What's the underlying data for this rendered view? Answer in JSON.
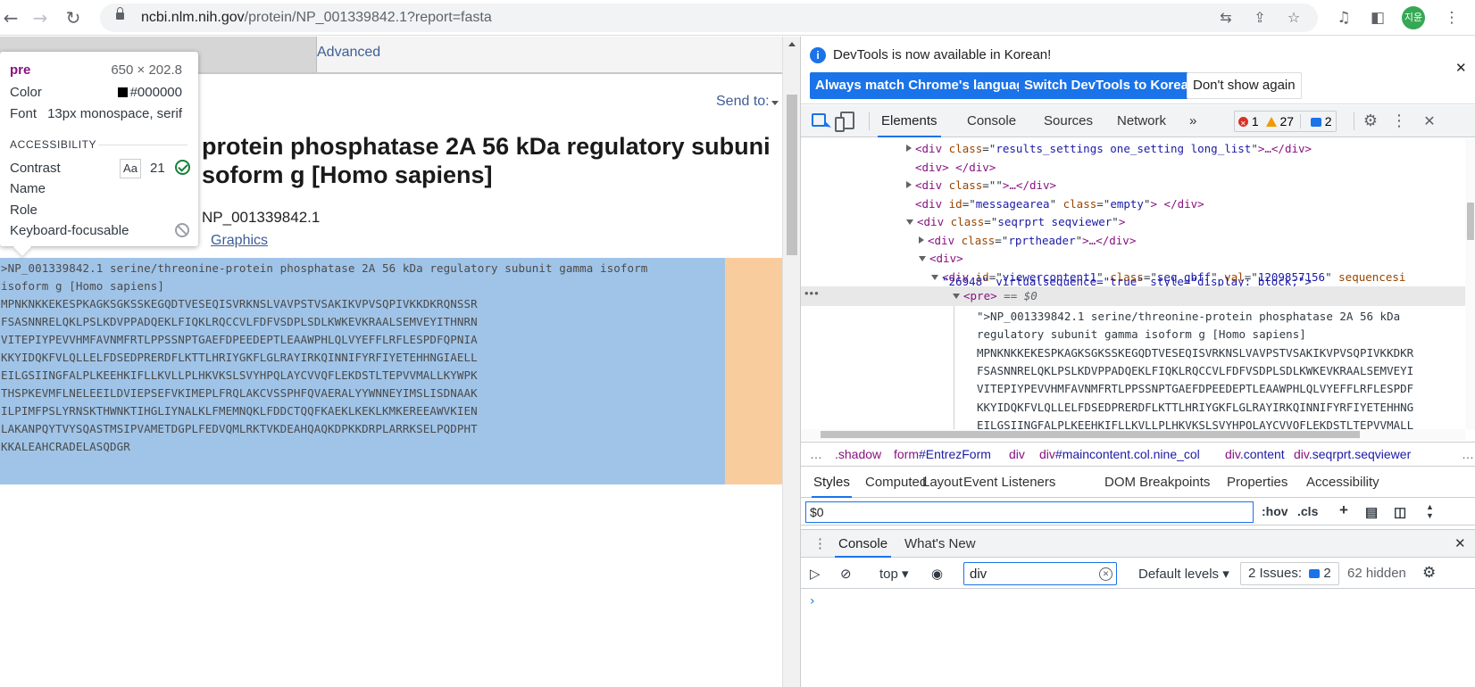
{
  "browser": {
    "url_host": "ncbi.nlm.nih.gov",
    "url_path": "/protein/NP_001339842.1?report=fasta",
    "avatar_label": "지윤",
    "colors": {
      "avatar": "#34a853"
    }
  },
  "page": {
    "advanced_link": "Advanced",
    "send_to": "Send to:",
    "title_line1": "protein phosphatase 2A 56 kDa regulatory subuni",
    "title_line2": "soform g [Homo sapiens]",
    "accession": "NP_001339842.1",
    "graphics_link": "Graphics",
    "fasta_lines": [
      ">NP_001339842.1 serine/threonine-protein phosphatase 2A 56 kDa regulatory subunit gamma isoform",
      "isoform g [Homo sapiens]",
      "MPNKNKKEKESPKAGKSGKSSKEGQDTVESEQISVRKNSLVAVPSTVSAKIKVPVSQPIVKKDKRQNSSR",
      "FSASNNRELQKLPSLKDVPPADQEKLFIQKLRQCCVLFDFVSDPLSDLKWKEVKRAALSEMVEYITHNRN",
      "VITEPIYPEVVHMFAVNMFRTLPPSSNPTGAEFDPEEDEPTLEAAWPHLQLVYEFFLRFLESPDFQPNIA",
      "KKYIDQKFVLQLLELFDSEDPRERDFLKTTLHRIYGKFLGLRAYIRKQINNIFYRFIYETEHHNGIAELL",
      "EILGSIINGFALPLKEEHKIFLLKVLLPLHKVKSLSVYHPQLAYCVVQFLEKDSTLTEPVVMALLKYWPK",
      "THSPKEVMFLNELEEILDVIEPSEFVKIMEPLFRQLAKCVSSPHFQVAERALYYWNNEYIMSLISDNAAK",
      "ILPIMFPSLYRNSKTHWNKTIHGLIYNALKLFMEMNQKLFDDCTQQFKAEKLKEKLKMKEREEAWVKIEN",
      "LAKANPQYTVYSQASTMSIPVAMETDGPLFEDVQMLRKTVKDEAHQAQKDPKKDRPLARRKSELPQDPHT",
      "KKALEAHCRADELASQDGR"
    ],
    "colors": {
      "pre_selection": "#a0c4e8",
      "padding_highlight": "#f9cc9d",
      "link": "#3e5d96"
    }
  },
  "tooltip": {
    "tag": "pre",
    "size": "650 × 202.8",
    "color_label": "Color",
    "color_value": "#000000",
    "font_label": "Font",
    "font_value": "13px monospace, serif",
    "section": "ACCESSIBILITY",
    "contrast_label": "Contrast",
    "contrast_aa": "Aa",
    "contrast_value": "21",
    "name_label": "Name",
    "role_label": "Role",
    "focus_label": "Keyboard-focusable"
  },
  "devtools": {
    "infobar": {
      "message": "DevTools is now available in Korean!",
      "btn_match": "Always match Chrome's language",
      "btn_switch": "Switch DevTools to Korean",
      "btn_dismiss": "Don't show again"
    },
    "tabs": [
      "Elements",
      "Console",
      "Sources",
      "Network"
    ],
    "more_tabs": "»",
    "errors": "1",
    "warnings": "27",
    "messages": "2",
    "elements": {
      "lines": [
        {
          "tag": "div",
          "attrs": [
            [
              "class",
              "results_settings one_setting long_list"
            ]
          ],
          "suffix": ">…</div>"
        },
        {
          "tag": "div",
          "attrs": [],
          "suffix": "> </div>"
        },
        {
          "tag": "div",
          "attrs": [
            [
              "class",
              ""
            ]
          ],
          "suffix": ">…</div>"
        },
        {
          "tag": "div",
          "attrs": [
            [
              "id",
              "messagearea"
            ],
            [
              "class",
              "empty"
            ]
          ],
          "suffix": "> </div>"
        },
        {
          "tag": "div",
          "attrs": [
            [
              "class",
              "seqrprt seqviewer"
            ]
          ],
          "suffix": ">"
        },
        {
          "tag": "div",
          "attrs": [
            [
              "class",
              "rprtheader"
            ]
          ],
          "suffix": ">…</div>"
        },
        {
          "tag": "div",
          "attrs": [],
          "suffix": ">"
        },
        {
          "tag": "div",
          "attrs": [
            [
              "id",
              "viewercontent1"
            ],
            [
              "class",
              "seq gbff"
            ],
            [
              "val",
              "1209857156"
            ],
            [
              "sequencesi",
              ""
            ]
          ],
          "suffix": ""
        }
      ],
      "continuation": "\"26948\" virtualsequence=\"true\" style=\"display: block;\">",
      "selected_tag": "<pre>",
      "selected_ref": " == $0",
      "seq_lines": [
        "\">NP_001339842.1 serine/threonine-protein phosphatase 2A 56 kDa",
        "regulatory subunit gamma isoform g [Homo sapiens]",
        "MPNKNKKEKESPKAGKSGKSSKEGQDTVESEQISVRKNSLVAVPSTVSAKIKVPVSQPIVKKDKR",
        "FSASNNRELQKLPSLKDVPPADQEKLFIQKLRQCCVLFDFVSDPLSDLKWKEVKRAALSEMVEYI",
        "VITEPIYPEVVHMFAVNMFRTLPPSSNPTGAEFDPEEDEPTLEAAWPHLQLVYEFFLRFLESPDF",
        "KKYIDQKFVLQLLELFDSEDPRERDFLKTTLHRIYGKFLGLRAYIRKQINNIFYRFIYETEHHNG",
        "EILGSIINGFALPLKEEHKIFLLKVLLPLHKVKSLSVYHPQLAYCVVQFLEKDSTLTEPVVMALL"
      ]
    },
    "breadcrumbs": [
      {
        "tag": ".shadow",
        "cls": ""
      },
      {
        "tag": "form",
        "cls": "#EntrezForm"
      },
      {
        "tag": "div",
        "cls": ""
      },
      {
        "tag": "div",
        "cls": "#maincontent.col.nine_col"
      },
      {
        "tag": "div",
        "cls": ".content"
      },
      {
        "tag": "div",
        "cls": ".seqrprt.seqviewer"
      }
    ],
    "style_tabs": [
      "Styles",
      "Computed",
      "Layout",
      "Event Listeners",
      "DOM Breakpoints",
      "Properties",
      "Accessibility"
    ],
    "styles_filter": "$0",
    "hov": ":hov",
    "cls": ".cls",
    "drawer_tabs": [
      "Console",
      "What's New"
    ],
    "console": {
      "context": "top",
      "filter_value": "div",
      "levels": "Default levels",
      "issues_label": "2 Issues:",
      "issues_count": "2",
      "hidden": "62 hidden",
      "prompt": "›"
    },
    "colors": {
      "accent": "#1a73e8",
      "tag": "#881280",
      "attr_name": "#994500",
      "attr_value": "#1a1aa6"
    }
  }
}
